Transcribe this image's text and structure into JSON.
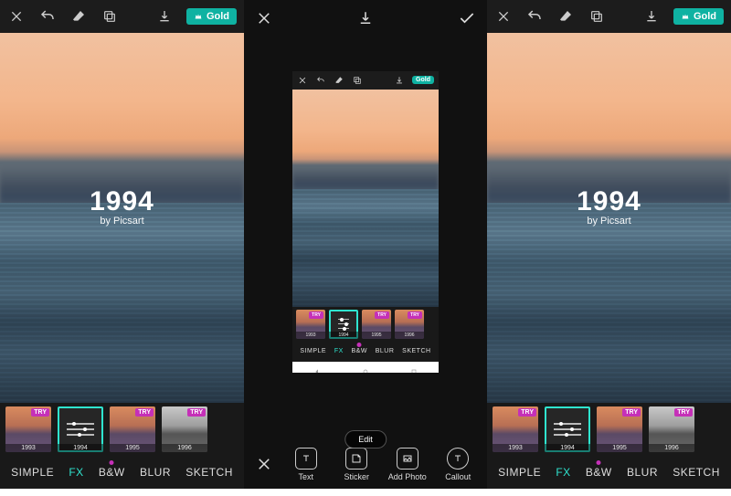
{
  "gold_label": "Gold",
  "brand": {
    "year": "1994",
    "byline": "by Picsart"
  },
  "try_label": "TRY",
  "edit_label": "Edit",
  "filters": [
    {
      "name": "1993",
      "try": true,
      "selected": false
    },
    {
      "name": "1994",
      "try": false,
      "selected": true
    },
    {
      "name": "1995",
      "try": true,
      "selected": false
    },
    {
      "name": "1996",
      "try": true,
      "selected": false,
      "bw": true
    }
  ],
  "categories": [
    {
      "label": "SIMPLE",
      "active": false,
      "dot": false
    },
    {
      "label": "FX",
      "active": true,
      "dot": false
    },
    {
      "label": "B&W",
      "active": false,
      "dot": true
    },
    {
      "label": "BLUR",
      "active": false,
      "dot": false
    },
    {
      "label": "SKETCH",
      "active": false,
      "dot": false
    }
  ],
  "bottom_tools": [
    {
      "label": "Text"
    },
    {
      "label": "Sticker"
    },
    {
      "label": "Add Photo"
    },
    {
      "label": "Callout"
    }
  ],
  "mini": {
    "filters": [
      {
        "name": "1993",
        "try": true,
        "selected": false
      },
      {
        "name": "1994",
        "try": false,
        "selected": true
      },
      {
        "name": "1995",
        "try": true,
        "selected": false
      },
      {
        "name": "1996",
        "try": true,
        "selected": false
      }
    ]
  }
}
